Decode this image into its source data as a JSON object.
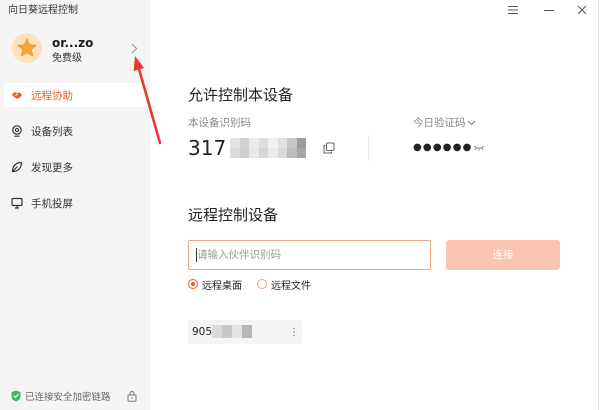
{
  "app": {
    "title": "向日葵远程控制"
  },
  "colors": {
    "accent": "#f2592a",
    "input_border": "#f3a581",
    "connect_button_disabled": "#fbc4b1",
    "secure_green": "#3cb96a",
    "annotation_red": "#e53a35"
  },
  "user": {
    "name": "or...zo",
    "tier": "免费级",
    "avatar_icon": "star-avatar-icon"
  },
  "nav": [
    {
      "label": "远程协助",
      "icon": "remote-assist-icon",
      "active": true
    },
    {
      "label": "设备列表",
      "icon": "device-list-icon",
      "active": false
    },
    {
      "label": "发现更多",
      "icon": "discover-icon",
      "active": false
    },
    {
      "label": "手机投屏",
      "icon": "screen-cast-icon",
      "active": false
    }
  ],
  "footer": {
    "security_status": "已连接安全加密链路",
    "status_icon": "shield-check-icon",
    "lock_icon": "lock-icon"
  },
  "window_controls": {
    "menu_icon": "menu-icon",
    "minimize_icon": "minimize-icon",
    "close_icon": "close-icon"
  },
  "allow_control": {
    "heading": "允许控制本设备",
    "device_id_label": "本设备识别码",
    "device_id_visible": "317",
    "copy_icon": "copy-icon",
    "verify_code_label": "今日验证码",
    "verify_code_masked": "●●●●●●",
    "reveal_icon": "eye-closed-icon"
  },
  "remote_control": {
    "heading": "远程控制设备",
    "partner_id_input": {
      "value": "",
      "placeholder": "请输入伙伴识别码"
    },
    "connect_label": "连接",
    "modes": [
      {
        "label": "远程桌面",
        "selected": true
      },
      {
        "label": "远程文件",
        "selected": false
      }
    ]
  },
  "recent_devices": [
    {
      "id_visible": "905",
      "menu_icon": "more-vertical-icon"
    }
  ]
}
